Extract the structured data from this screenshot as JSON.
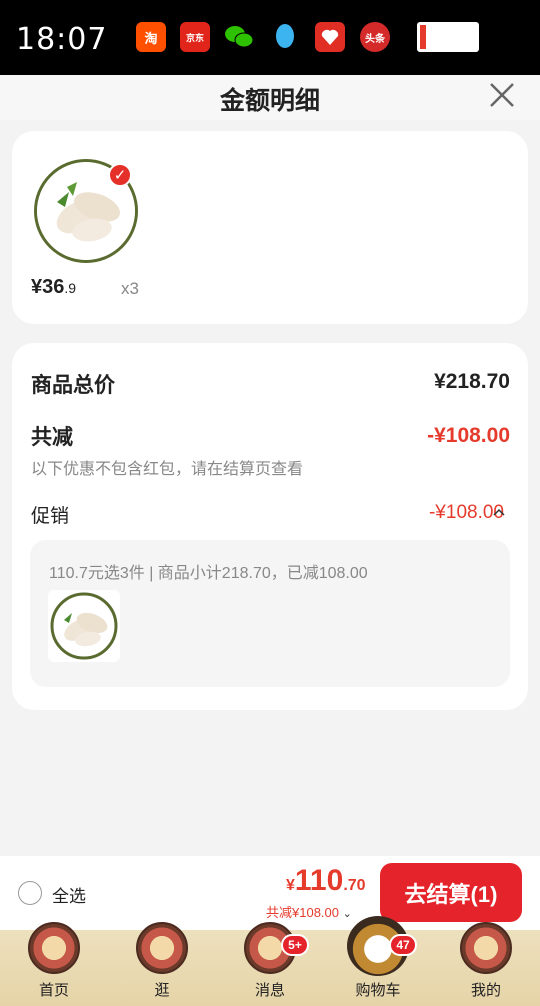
{
  "status_bar": {
    "time": "18:07",
    "apps": [
      {
        "name": "taobao-icon",
        "label": "淘",
        "color": "#ff5000"
      },
      {
        "name": "jd-icon",
        "label": "京东",
        "color": "#e1251b"
      },
      {
        "name": "wechat-icon",
        "label": "",
        "color": "#2dc100"
      },
      {
        "name": "qq-icon",
        "label": "",
        "color": "#3cb4f0"
      },
      {
        "name": "pinduoduo-icon",
        "label": "",
        "color": "#e02e24"
      },
      {
        "name": "toutiao-icon",
        "label": "头条",
        "color": "#d52a2a"
      }
    ]
  },
  "header": {
    "title": "金额明细"
  },
  "product": {
    "price_main": "¥36",
    "price_decimal": ".9",
    "quantity": "x3"
  },
  "detail": {
    "total_label": "商品总价",
    "total_value": "¥218.70",
    "reduce_label": "共减",
    "reduce_value": "-¥108.00",
    "reduce_note": "以下优惠不包含红包，请在结算页查看",
    "promo_label": "促销",
    "promo_value": "-¥108.00",
    "promo_detail": "110.7元选3件 | 商品小计218.70，已减108.00"
  },
  "bottom_bar": {
    "select_all": "全选",
    "total_currency": "¥",
    "total_int": "110",
    "total_dec": ".70",
    "total_discount": "共减¥108.00",
    "checkout": "去结算(1)"
  },
  "tabs": [
    {
      "label": "首页",
      "badge": ""
    },
    {
      "label": "逛",
      "badge": ""
    },
    {
      "label": "消息",
      "badge": "5+"
    },
    {
      "label": "购物车",
      "badge": "47"
    },
    {
      "label": "我的",
      "badge": ""
    }
  ]
}
